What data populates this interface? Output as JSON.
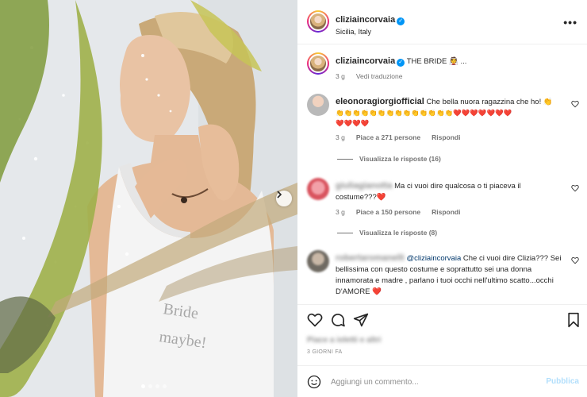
{
  "post": {
    "username": "cliziaincorvaia",
    "location": "Sicilia, Italy",
    "more_label": "•••"
  },
  "caption": {
    "username": "cliziaincorvaia",
    "text": "THE BRIDE 👰 ...",
    "time": "3 g",
    "translate": "Vedi traduzione"
  },
  "photo": {
    "shirt_text_line1": "Bride",
    "shirt_text_line2": "maybe!",
    "carousel_next_label": "›"
  },
  "comments": [
    {
      "username": "eleonoragiorgiofficial",
      "text": "Che bella nuora ragazzina che ho! 👏",
      "emoji_line1": "👏👏👏👏👏👏👏👏👏👏👏👏👏👏❤️❤️❤️❤️❤️❤️❤️",
      "emoji_line2": "❤️❤️❤️❤️",
      "time": "3 g",
      "likes": "Piace a 271 persone",
      "reply": "Rispondi",
      "view_replies": "Visualizza le risposte (16)"
    },
    {
      "username": "giuliagianotta",
      "text": "Ma ci vuoi dire qualcosa o ti piaceva il costume???❤️",
      "time": "3 g",
      "likes": "Piace a 150 persone",
      "reply": "Rispondi",
      "view_replies": "Visualizza le risposte (8)"
    },
    {
      "username": "robertaromanelli",
      "mention": "@cliziaincorvaia",
      "text": "Che ci vuoi dire Clizia??? Sei bellissima con questo costume e soprattutto sei una donna innamorata e madre , parlano i tuoi occhi nell'ultimo scatto...occhi D'AMORE ❤️"
    }
  ],
  "footer": {
    "likes_text": "Piace a ioletti e altri",
    "date_text": "3 GIORNI FA",
    "comment_placeholder": "Aggiungi un commento...",
    "publish_label": "Pubblica"
  },
  "icons": {
    "like": "heart-icon",
    "comment": "speech-bubble-icon",
    "share": "paper-plane-icon",
    "save": "bookmark-icon",
    "emoji": "smiley-icon"
  },
  "colors": {
    "verified": "#0095f6",
    "mention": "#00376b",
    "publish_disabled": "#b2dffc"
  }
}
